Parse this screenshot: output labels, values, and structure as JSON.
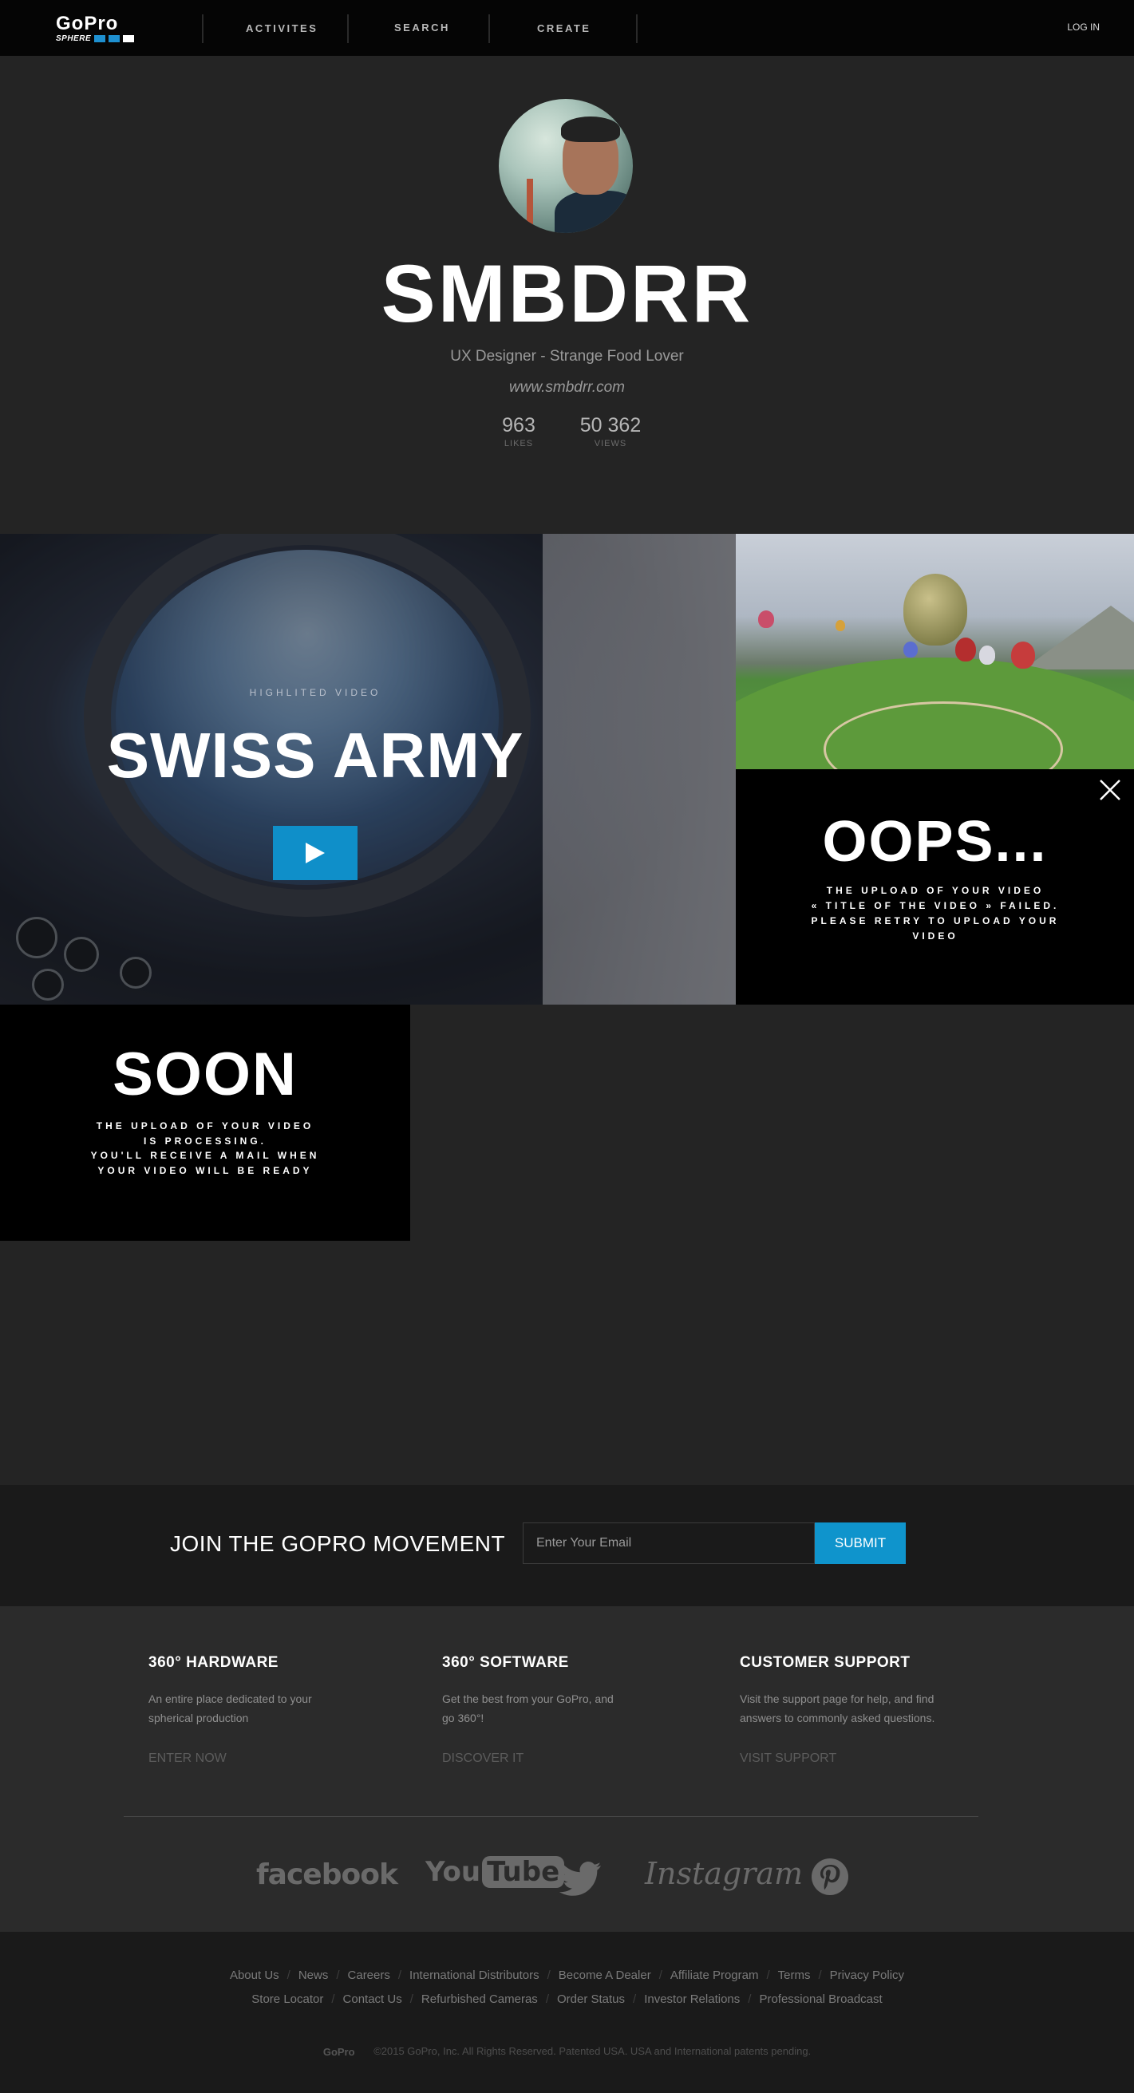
{
  "nav": {
    "logo": "GoPro",
    "logo_sub": "SPHERE",
    "items": [
      "ACTIVITES",
      "SEARCH",
      "CREATE"
    ],
    "login": "LOG IN"
  },
  "profile": {
    "username": "SMBDRR",
    "bio": "UX Designer - Strange Food Lover",
    "website": "www.smbdrr.com",
    "likes_value": "963",
    "likes_label": "LIKES",
    "views_value": "50 362",
    "views_label": "VIEWS"
  },
  "highlight": {
    "label": "HIGHLITED VIDEO",
    "title": "SWISS ARMY"
  },
  "oops": {
    "title": "OOPS...",
    "lines": [
      "THE UPLOAD OF YOUR VIDEO",
      "« TITLE OF THE VIDEO » FAILED.",
      "PLEASE RETRY TO UPLOAD YOUR",
      "VIDEO"
    ]
  },
  "soon": {
    "title": "SOON",
    "lines": [
      "THE UPLOAD OF YOUR VIDEO",
      "IS PROCESSING.",
      "YOU'LL RECEIVE A MAIL WHEN",
      "YOUR VIDEO WILL BE READY"
    ]
  },
  "newsletter": {
    "heading": "JOIN THE GOPRO MOVEMENT",
    "placeholder": "Enter Your Email",
    "submit": "SUBMIT"
  },
  "features": [
    {
      "title": "360° HARDWARE",
      "desc": "An entire place dedicated to your spherical production",
      "link": "ENTER NOW"
    },
    {
      "title": "360° SOFTWARE",
      "desc": "Get the best from your GoPro, and go 360°!",
      "link": "DISCOVER IT"
    },
    {
      "title": "CUSTOMER SUPPORT",
      "desc": "Visit the support page for help, and find answers to commonly asked questions.",
      "link": "VISIT SUPPORT"
    }
  ],
  "social": {
    "facebook": "facebook",
    "youtube_you": "You",
    "youtube_tube": "Tube",
    "instagram": "Instagram"
  },
  "footer_links": {
    "row1": [
      "About Us",
      "News",
      "Careers",
      "International Distributors",
      "Become A Dealer",
      "Affiliate Program",
      "Terms",
      "Privacy Policy"
    ],
    "row2": [
      "Store Locator",
      "Contact Us",
      "Refurbished Cameras",
      "Order Status",
      "Investor Relations",
      "Professional Broadcast"
    ]
  },
  "copyright": {
    "mini_logo": "GoPro",
    "text": "©2015 GoPro, Inc. All Rights Reserved. Patented USA. USA and International patents pending."
  },
  "colors": {
    "accent": "#0f94cc",
    "background": "#242424",
    "nav": "#050505"
  }
}
